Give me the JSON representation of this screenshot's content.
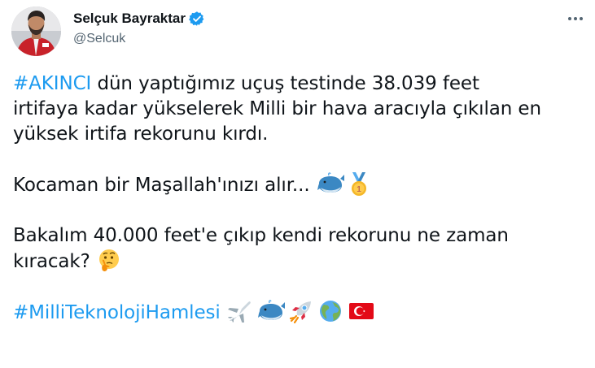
{
  "author": {
    "display_name": "Selçuk Bayraktar",
    "handle": "@Selcuk",
    "verified": true,
    "avatar_icon": "profile-photo"
  },
  "tweet": {
    "para1": {
      "hashtag": "#AKINCI",
      "line1_rest": " dün yaptığımız uçuş testinde 38.039 feet",
      "line2": "irtifaya kadar yükselerek Milli bir hava aracıyla çıkılan en",
      "line3": "yüksek irtifa rekorunu kırdı."
    },
    "para2": {
      "text": "Kocaman bir Maşallah'ınızı alır...",
      "emojis": [
        "whale-icon",
        "gold-medal-icon"
      ]
    },
    "para3": {
      "line1": "Bakalım 40.000 feet'e çıkıp kendi rekorunu ne zaman",
      "line2": "kıracak?",
      "emojis": [
        "thinking-face-icon"
      ]
    },
    "para4": {
      "hashtag": "#MilliTeknolojiHamlesi",
      "emojis": [
        "airplane-icon",
        "whale-icon",
        "rocket-icon",
        "globe-icon",
        "turkey-flag-icon"
      ]
    }
  },
  "colors": {
    "hashtag": "#1d9bf0",
    "text": "#0f1419",
    "secondary": "#536471",
    "verified": "#1d9bf0"
  }
}
